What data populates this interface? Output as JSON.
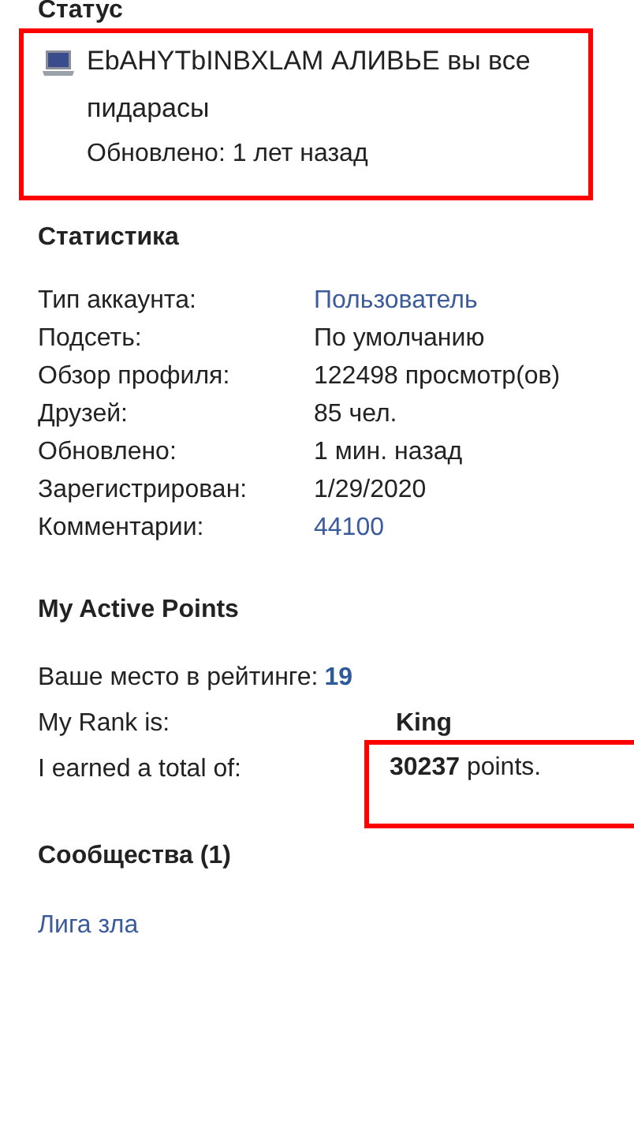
{
  "status": {
    "title": "Статус",
    "highlighted": true,
    "text": "EbAHYTbINBXLAM АЛИВЬЕ вы все пидарасы",
    "updated": "Обновлено: 1 лет назад"
  },
  "statistics": {
    "title": "Статистика",
    "rows": [
      {
        "label": "Тип аккаунта:",
        "value": "Пользователь",
        "kind": "link"
      },
      {
        "label": "Подсеть:",
        "value": "По умолчанию",
        "kind": "text"
      },
      {
        "label": "Обзор профиля:",
        "value": "122498 просмотр(ов)",
        "kind": "text"
      },
      {
        "label": "Друзей:",
        "value": "85 чел.",
        "kind": "text"
      },
      {
        "label": "Обновлено:",
        "value": "1 мин. назад",
        "kind": "text"
      },
      {
        "label": "Зарегистрирован:",
        "value": "1/29/2020",
        "kind": "text"
      },
      {
        "label": "Комментарии:",
        "value": "44100",
        "kind": "link"
      }
    ]
  },
  "active_points": {
    "title": "My Active Points",
    "rank_place": {
      "label": "Ваше место в рейтинге:",
      "value": "19"
    },
    "rank": {
      "label": "My Rank is:",
      "value": "King"
    },
    "total": {
      "label": "I earned a total of:",
      "value": "**30237** points.",
      "highlighted": true
    }
  },
  "communities": {
    "title": "Сообщества (1)",
    "items": [
      "Лига зла"
    ]
  }
}
